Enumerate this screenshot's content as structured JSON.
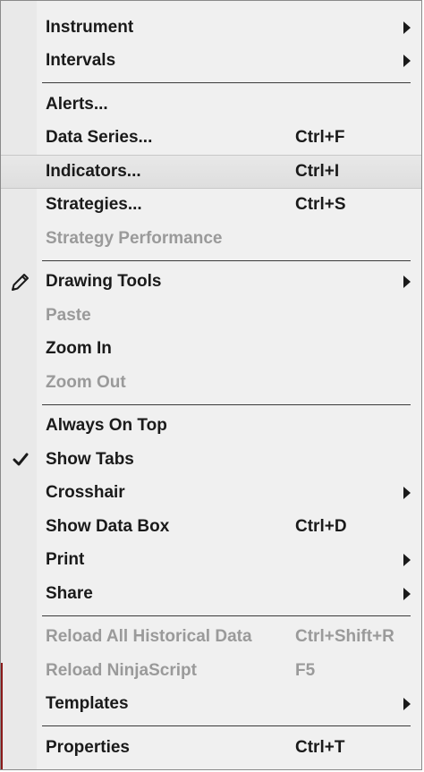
{
  "menu": {
    "groups": [
      [
        {
          "label": "Instrument",
          "shortcut": "",
          "submenu": true,
          "disabled": false
        },
        {
          "label": "Intervals",
          "shortcut": "",
          "submenu": true,
          "disabled": false
        }
      ],
      [
        {
          "label": "Alerts...",
          "shortcut": "",
          "submenu": false,
          "disabled": false
        },
        {
          "label": "Data Series...",
          "shortcut": "Ctrl+F",
          "submenu": false,
          "disabled": false
        },
        {
          "label": "Indicators...",
          "shortcut": "Ctrl+I",
          "submenu": false,
          "disabled": false,
          "highlighted": true
        },
        {
          "label": "Strategies...",
          "shortcut": "Ctrl+S",
          "submenu": false,
          "disabled": false
        },
        {
          "label": "Strategy Performance",
          "shortcut": "",
          "submenu": false,
          "disabled": true
        }
      ],
      [
        {
          "label": "Drawing Tools",
          "shortcut": "",
          "submenu": true,
          "disabled": false,
          "icon": "pencil-icon"
        },
        {
          "label": "Paste",
          "shortcut": "",
          "submenu": false,
          "disabled": true
        },
        {
          "label": "Zoom In",
          "shortcut": "",
          "submenu": false,
          "disabled": false
        },
        {
          "label": "Zoom Out",
          "shortcut": "",
          "submenu": false,
          "disabled": true
        }
      ],
      [
        {
          "label": "Always On Top",
          "shortcut": "",
          "submenu": false,
          "disabled": false
        },
        {
          "label": "Show Tabs",
          "shortcut": "",
          "submenu": false,
          "disabled": false,
          "icon": "checkmark-icon"
        },
        {
          "label": "Crosshair",
          "shortcut": "",
          "submenu": true,
          "disabled": false
        },
        {
          "label": "Show Data Box",
          "shortcut": "Ctrl+D",
          "submenu": false,
          "disabled": false
        },
        {
          "label": "Print",
          "shortcut": "",
          "submenu": true,
          "disabled": false
        },
        {
          "label": "Share",
          "shortcut": "",
          "submenu": true,
          "disabled": false
        }
      ],
      [
        {
          "label": "Reload All Historical Data",
          "shortcut": "Ctrl+Shift+R",
          "submenu": false,
          "disabled": true
        },
        {
          "label": "Reload NinjaScript",
          "shortcut": "F5",
          "submenu": false,
          "disabled": true
        },
        {
          "label": "Templates",
          "shortcut": "",
          "submenu": true,
          "disabled": false
        }
      ],
      [
        {
          "label": "Properties",
          "shortcut": "Ctrl+T",
          "submenu": false,
          "disabled": false
        }
      ]
    ]
  },
  "colors": {
    "background": "#f0f0f0",
    "gutter": "#e9e9e9",
    "text": "#1a1a1a",
    "disabled_text": "#9a9a9a",
    "separator": "#3a3a3a"
  }
}
